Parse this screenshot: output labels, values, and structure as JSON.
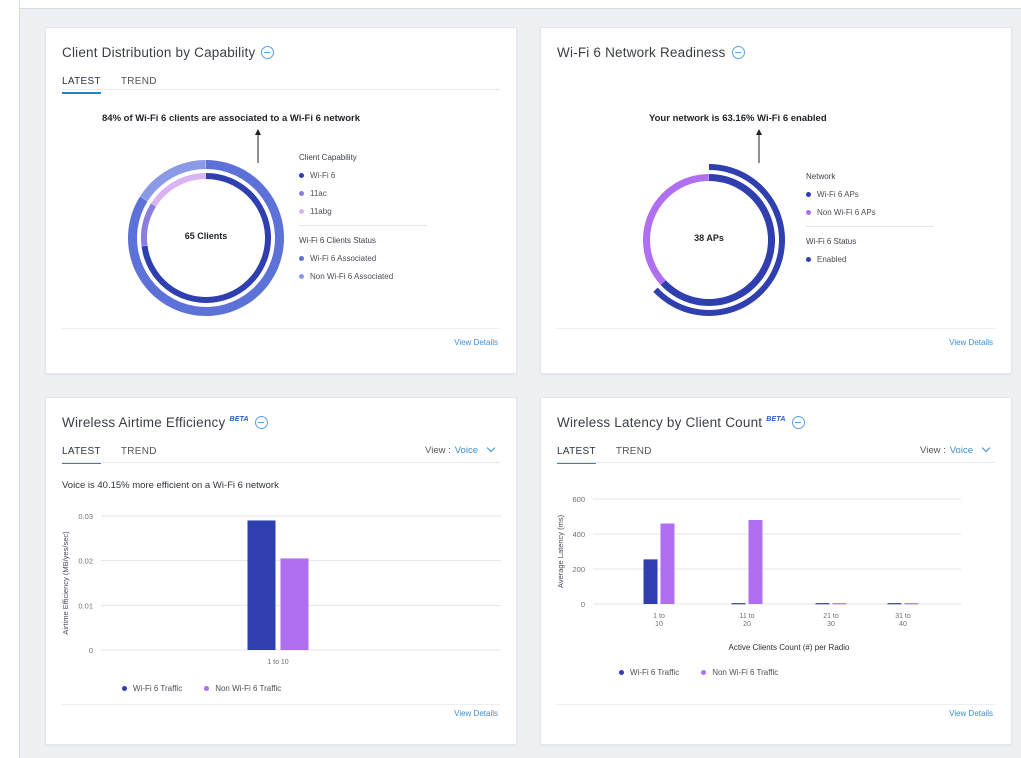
{
  "colors": {
    "wifi6": "#2f3fb0",
    "wifi6_light": "#5c72d8",
    "ac": "#8a7fe0",
    "abg": "#dab4f2",
    "non_wifi6": "#b06ef0",
    "accent": "#3b8fd6"
  },
  "icons": [
    "info-icon",
    "chevron-down-icon"
  ],
  "cards": {
    "client_distribution": {
      "title": "Client Distribution by Capability",
      "tabs": [
        "LATEST",
        "TREND"
      ],
      "active_tab": "LATEST",
      "headline": "84% of Wi-Fi 6 clients are associated to a Wi-Fi 6 network",
      "center_label": "65 Clients",
      "legend": {
        "capability_title": "Client Capability",
        "capability_items": [
          "Wi-Fi 6",
          "11ac",
          "11abg"
        ],
        "status_title": "Wi-Fi 6 Clients Status",
        "status_items": [
          "Wi-Fi 6 Associated",
          "Non Wi-Fi 6 Associated"
        ]
      },
      "view_details": "View Details"
    },
    "network_readiness": {
      "title": "Wi-Fi 6 Network Readiness",
      "headline": "Your network is 63.16% Wi-Fi 6 enabled",
      "center_label": "38 APs",
      "legend": {
        "network_title": "Network",
        "network_items": [
          "Wi-Fi 6 APs",
          "Non Wi-Fi 6 APs"
        ],
        "status_title": "Wi-Fi 6 Status",
        "status_items": [
          "Enabled"
        ]
      },
      "view_details": "View Details"
    },
    "airtime_efficiency": {
      "title": "Wireless Airtime Efficiency",
      "beta": "BETA",
      "tabs": [
        "LATEST",
        "TREND"
      ],
      "active_tab": "LATEST",
      "view_label": "View :",
      "view_value": "Voice",
      "subline": "Voice is 40.15% more efficient on a Wi-Fi 6 network",
      "legend": [
        "Wi-Fi 6 Traffic",
        "Non Wi-Fi 6 Traffic"
      ],
      "view_details": "View Details"
    },
    "latency": {
      "title": "Wireless Latency by Client Count",
      "beta": "BETA",
      "tabs": [
        "LATEST",
        "TREND"
      ],
      "active_tab": "LATEST",
      "view_label": "View :",
      "view_value": "Voice",
      "legend": [
        "Wi-Fi 6 Traffic",
        "Non Wi-Fi 6 Traffic"
      ],
      "view_details": "View Details"
    }
  },
  "chart_data": [
    {
      "type": "pie",
      "title": "Client Distribution by Capability",
      "rings": [
        {
          "name": "Client Capability",
          "slices": [
            {
              "label": "Wi-Fi 6",
              "value": 0.73
            },
            {
              "label": "11ac",
              "value": 0.11
            },
            {
              "label": "11abg",
              "value": 0.16
            }
          ]
        },
        {
          "name": "Wi-Fi 6 Clients Status",
          "slices": [
            {
              "label": "Wi-Fi 6 Associated",
              "value": 0.84
            },
            {
              "label": "Non Wi-Fi 6 Associated",
              "value": 0.16
            }
          ]
        }
      ],
      "center_label": "65 Clients"
    },
    {
      "type": "pie",
      "title": "Wi-Fi 6 Network Readiness",
      "rings": [
        {
          "name": "Network",
          "slices": [
            {
              "label": "Wi-Fi 6 APs",
              "value": 0.6316
            },
            {
              "label": "Non Wi-Fi 6 APs",
              "value": 0.3684
            }
          ]
        },
        {
          "name": "Wi-Fi 6 Status",
          "slices": [
            {
              "label": "Enabled",
              "value": 0.6316
            }
          ]
        }
      ],
      "center_label": "38 APs"
    },
    {
      "type": "bar",
      "title": "Wireless Airtime Efficiency",
      "categories": [
        "1 to 10"
      ],
      "series": [
        {
          "name": "Wi-Fi 6 Traffic",
          "values": [
            0.029
          ]
        },
        {
          "name": "Non Wi-Fi 6 Traffic",
          "values": [
            0.0205
          ]
        }
      ],
      "ylabel": "Airtime Efficiency (MB/yes/sec)",
      "yticks": [
        "0.03",
        "0.02",
        "0.01",
        "0"
      ],
      "ylim": [
        0,
        0.03
      ],
      "grid": true,
      "legend": "bottom"
    },
    {
      "type": "bar",
      "title": "Wireless Latency by Client Count",
      "categories": [
        "1 to 10",
        "11 to 20",
        "21 to 30",
        "31 to 40"
      ],
      "series": [
        {
          "name": "Wi-Fi 6 Traffic",
          "values": [
            255,
            5,
            5,
            5
          ]
        },
        {
          "name": "Non Wi-Fi 6 Traffic",
          "values": [
            460,
            480,
            5,
            5
          ]
        }
      ],
      "xlabel": "Active Clients Count (#) per Radio",
      "ylabel": "Average Latency (ms)",
      "yticks": [
        "600",
        "400",
        "200",
        "0"
      ],
      "ylim": [
        0,
        600
      ],
      "grid": true,
      "legend": "bottom"
    }
  ]
}
